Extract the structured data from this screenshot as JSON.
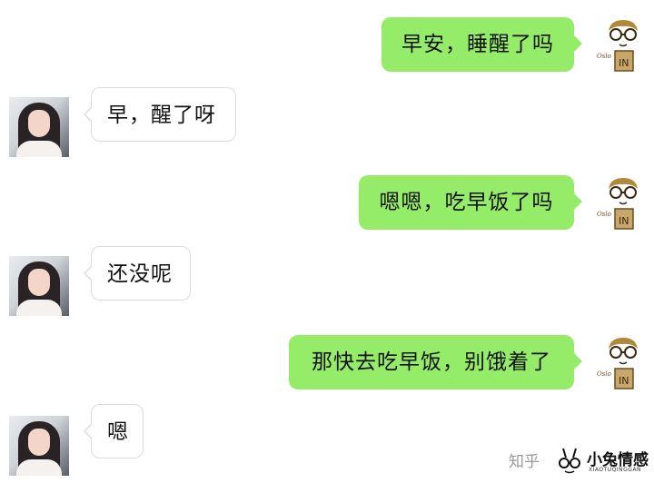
{
  "messages": [
    {
      "side": "right",
      "text": "早安，睡醒了吗",
      "avatar": "boy-sketch-avatar"
    },
    {
      "side": "left",
      "text": "早，醒了呀",
      "avatar": "girl-photo-avatar"
    },
    {
      "side": "right",
      "text": "嗯嗯，吃早饭了吗",
      "avatar": "boy-sketch-avatar"
    },
    {
      "side": "left",
      "text": "还没呢",
      "avatar": "girl-photo-avatar"
    },
    {
      "side": "right",
      "text": "那快去吃早饭，别饿着了",
      "avatar": "boy-sketch-avatar"
    },
    {
      "side": "left",
      "text": "嗯",
      "avatar": "girl-photo-avatar"
    }
  ],
  "watermark": {
    "platform": "知乎",
    "brand": "小兔情感",
    "brand_sub": "XIAOTUQINGGAN",
    "icon": "rabbit-glasses-logo-icon"
  },
  "colors": {
    "sent_bubble": "#95ec69",
    "received_bubble": "#ffffff",
    "received_border": "#dcdcdc",
    "background": "#ffffff"
  }
}
